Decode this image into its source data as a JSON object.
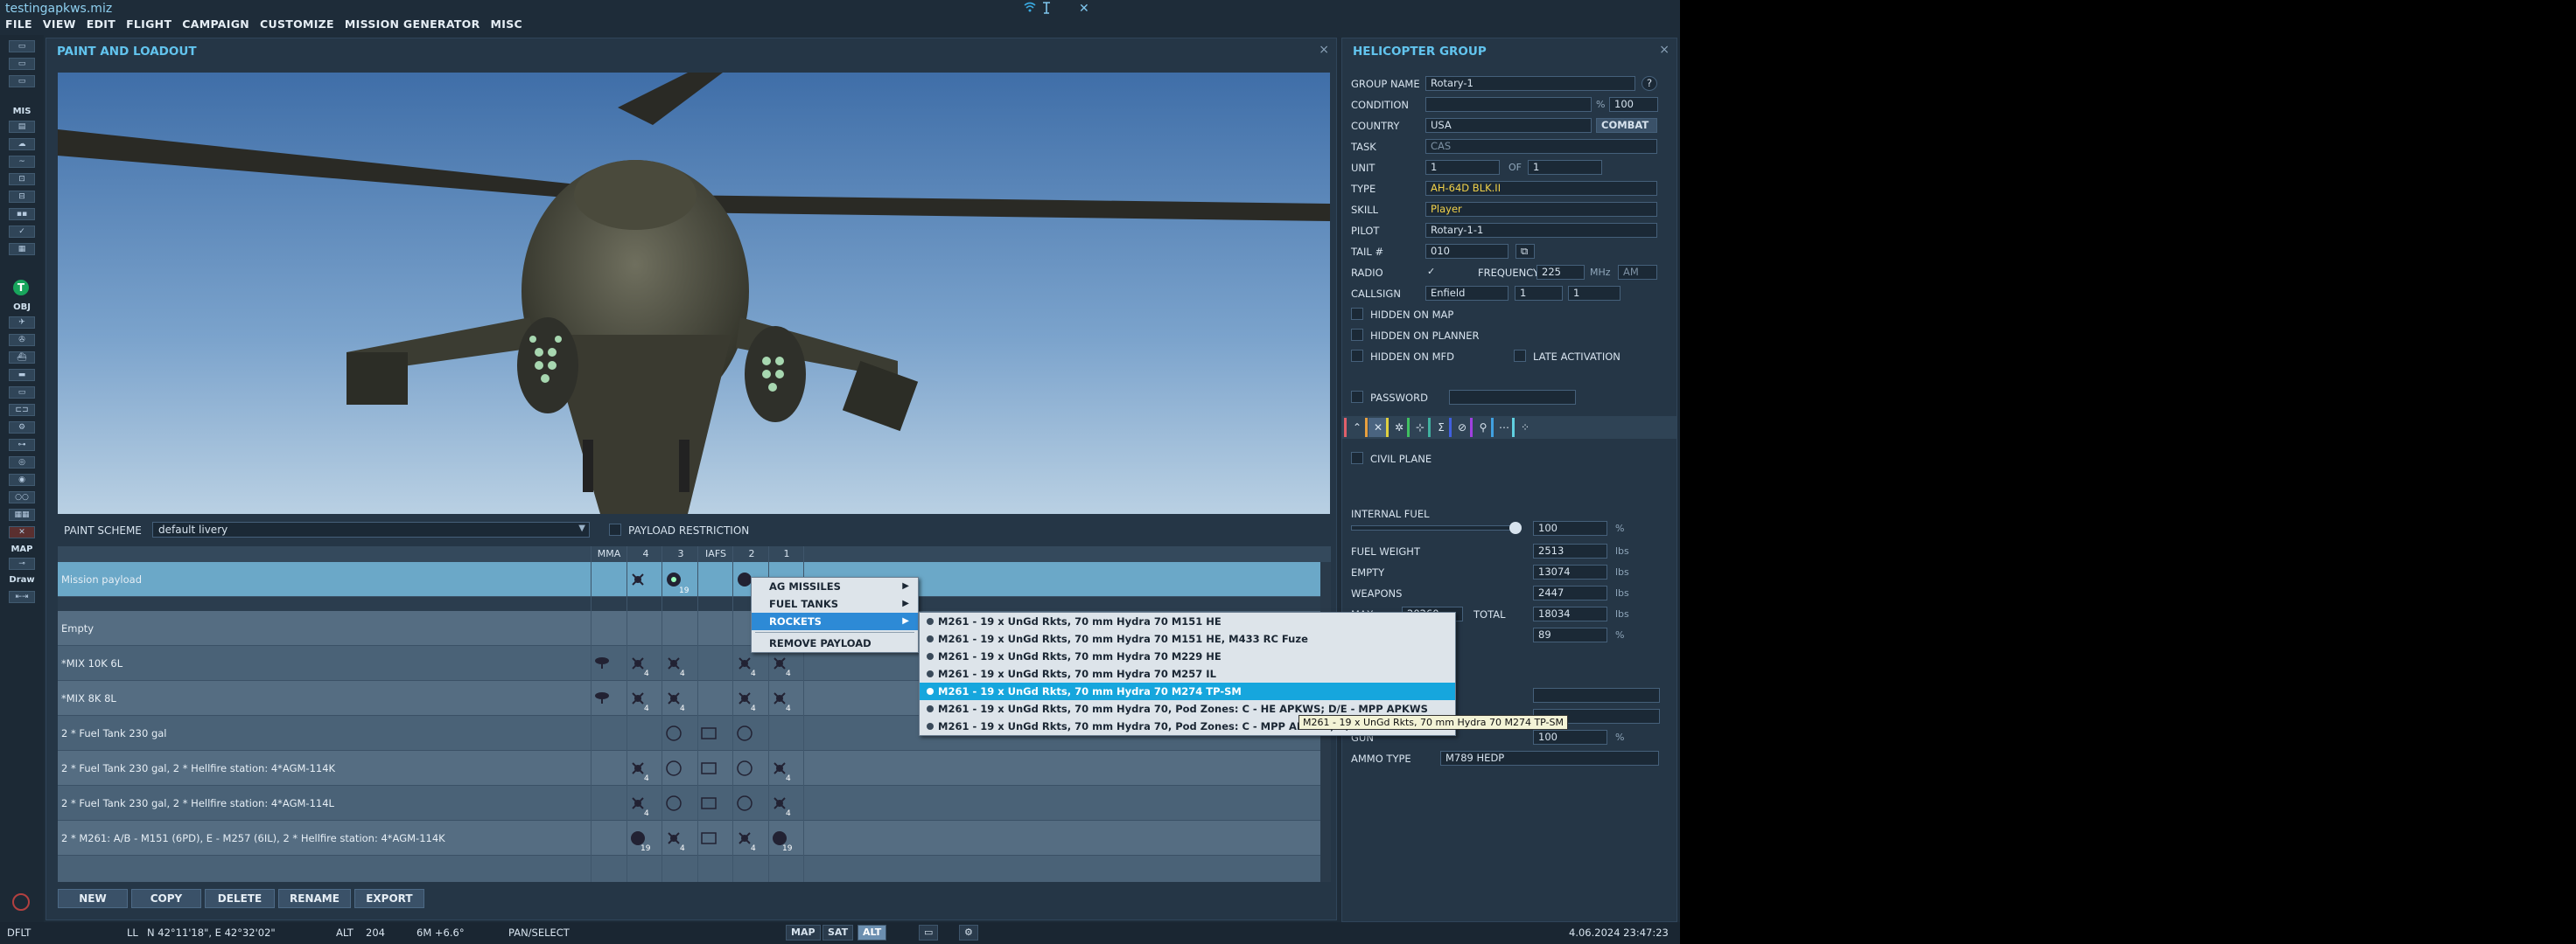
{
  "app": {
    "file_title": "testingapkws.miz"
  },
  "menu": [
    "FILE",
    "VIEW",
    "EDIT",
    "FLIGHT",
    "CAMPAIGN",
    "CUSTOMIZE",
    "MISSION GENERATOR",
    "MISC"
  ],
  "toolbar": {
    "mis_label": "MIS",
    "obj_label": "OBJ",
    "map_label": "MAP",
    "draw_label": "Draw"
  },
  "paint_loadout": {
    "title": "PAINT AND LOADOUT",
    "close": "×",
    "paint_scheme_label": "PAINT SCHEME",
    "paint_scheme_value": "default livery",
    "payload_restriction_label": "PAYLOAD RESTRICTION",
    "columns": [
      "MMA",
      "4",
      "3",
      "IAFS",
      "2",
      "1"
    ],
    "rows": [
      {
        "label": "Mission payload"
      },
      {
        "label": "Empty"
      },
      {
        "label": "*MIX 10K 6L"
      },
      {
        "label": "*MIX 8K 8L"
      },
      {
        "label": "2 * Fuel Tank 230 gal"
      },
      {
        "label": "2 * Fuel Tank 230 gal, 2 * Hellfire station: 4*AGM-114K"
      },
      {
        "label": "2 * Fuel Tank 230 gal, 2 * Hellfire station: 4*AGM-114L"
      },
      {
        "label": "2 * M261: A/B - M151 (6PD), E - M257 (6IL), 2 * Hellfire station: 4*AGM-114K"
      }
    ],
    "counts": {
      "c4": "4",
      "c19": "19"
    },
    "buttons": {
      "new": "NEW",
      "copy": "COPY",
      "delete": "DELETE",
      "rename": "RENAME",
      "export": "EXPORT"
    }
  },
  "context_menu": {
    "items": [
      "AG MISSILES",
      "FUEL TANKS",
      "ROCKETS",
      "REMOVE PAYLOAD"
    ],
    "rockets_submenu": [
      "M261 - 19 x UnGd Rkts, 70 mm Hydra 70 M151 HE",
      "M261 - 19 x UnGd Rkts, 70 mm Hydra 70 M151 HE, M433 RC Fuze",
      "M261 - 19 x UnGd Rkts, 70 mm Hydra 70 M229 HE",
      "M261 - 19 x UnGd Rkts, 70 mm Hydra 70 M257 IL",
      "M261 - 19 x UnGd Rkts, 70 mm Hydra 70 M274 TP-SM",
      "M261 - 19 x UnGd Rkts, 70 mm Hydra 70, Pod Zones: C - HE APKWS; D/E - MPP APKWS",
      "M261 - 19 x UnGd Rkts, 70 mm Hydra 70, Pod Zones: C - MPP APKWS; D/E - HE APKWS"
    ],
    "tooltip": "M261 - 19 x UnGd Rkts, 70 mm Hydra 70 M274 TP-SM"
  },
  "heli_group": {
    "title": "HELICOPTER GROUP",
    "close": "×",
    "group_name_label": "GROUP NAME",
    "group_name": "Rotary-1",
    "help": "?",
    "condition_label": "CONDITION",
    "condition_pct": "%",
    "condition_value": "100",
    "country_label": "COUNTRY",
    "country": "USA",
    "combat": "COMBAT",
    "task_label": "TASK",
    "task": "CAS",
    "unit_label": "UNIT",
    "unit": "1",
    "of_label": "OF",
    "of": "1",
    "type_label": "TYPE",
    "type": "AH-64D BLK.II",
    "skill_label": "SKILL",
    "skill": "Player",
    "pilot_label": "PILOT",
    "pilot": "Rotary-1-1",
    "tail_label": "TAIL #",
    "tail": "010",
    "radio_label": "RADIO",
    "radio_check": "✓",
    "frequency_label": "FREQUENCY",
    "frequency": "225",
    "mhz": "MHz",
    "am": "AM",
    "callsign_label": "CALLSIGN",
    "callsign": "Enfield",
    "callsign_n1": "1",
    "callsign_n2": "1",
    "hidden_on_map": "HIDDEN ON MAP",
    "hidden_on_planner": "HIDDEN ON PLANNER",
    "hidden_on_mfd": "HIDDEN ON MFD",
    "late_activation": "LATE ACTIVATION",
    "password_label": "PASSWORD",
    "civil_plane": "CIVIL PLANE",
    "internal_fuel_label": "INTERNAL FUEL",
    "internal_fuel": "100",
    "internal_fuel_level": 1.0,
    "fuel_weight_label": "FUEL WEIGHT",
    "fuel_weight": "2513",
    "empty_label": "EMPTY",
    "empty": "13074",
    "weapons_label": "WEAPONS",
    "weapons": "2447",
    "max_label": "MAX",
    "max": "20260",
    "total_label": "TOTAL",
    "total": "18034",
    "pct_value": "89",
    "guns_label": "GUN",
    "guns_value": "100",
    "ammo_type_label": "AMMO TYPE",
    "ammo_type": "M789 HEDP",
    "lbs": "lbs",
    "pct": "%"
  },
  "statusbar": {
    "profile": "DFLT",
    "ll_label": "LL",
    "coords": "N 42°11'18\", E 42°32'02\"",
    "alt_label": "ALT",
    "alt": "204",
    "magvar": "6M  +6.6°",
    "mode": "PAN/SELECT",
    "map_btn": "MAP",
    "sat_btn": "SAT",
    "alt_btn": "ALT",
    "datetime": "4.06.2024 23:47:23"
  },
  "colors": {
    "accent": "#62c4ee",
    "menu_highlight": "#16a6dd",
    "type_yellow": "#f2d24a"
  }
}
